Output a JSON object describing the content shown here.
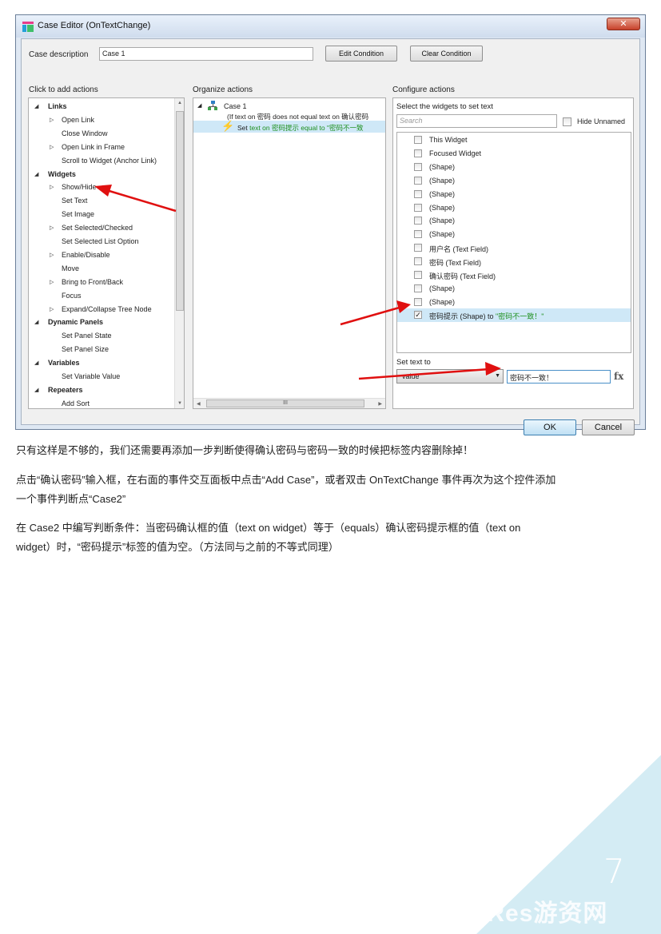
{
  "dialog": {
    "title": "Case Editor (OnTextChange)",
    "close_glyph": "✕",
    "case_description_label": "Case description",
    "case_description_value": "Case 1",
    "edit_condition_label": "Edit Condition",
    "clear_condition_label": "Clear Condition",
    "ok_label": "OK",
    "cancel_label": "Cancel"
  },
  "actions_panel": {
    "header": "Click to add actions",
    "rows": [
      {
        "label": "Links",
        "type": "category"
      },
      {
        "label": "Open Link",
        "type": "expandable"
      },
      {
        "label": "Close Window",
        "type": "item"
      },
      {
        "label": "Open Link in Frame",
        "type": "expandable"
      },
      {
        "label": "Scroll to Widget (Anchor Link)",
        "type": "item"
      },
      {
        "label": "Widgets",
        "type": "category"
      },
      {
        "label": "Show/Hide",
        "type": "expandable"
      },
      {
        "label": "Set Text",
        "type": "item"
      },
      {
        "label": "Set Image",
        "type": "item"
      },
      {
        "label": "Set Selected/Checked",
        "type": "expandable"
      },
      {
        "label": "Set Selected List Option",
        "type": "item"
      },
      {
        "label": "Enable/Disable",
        "type": "expandable"
      },
      {
        "label": "Move",
        "type": "item"
      },
      {
        "label": "Bring to Front/Back",
        "type": "expandable"
      },
      {
        "label": "Focus",
        "type": "item"
      },
      {
        "label": "Expand/Collapse Tree Node",
        "type": "expandable"
      },
      {
        "label": "Dynamic Panels",
        "type": "category"
      },
      {
        "label": "Set Panel State",
        "type": "item"
      },
      {
        "label": "Set Panel Size",
        "type": "item"
      },
      {
        "label": "Variables",
        "type": "category"
      },
      {
        "label": "Set Variable Value",
        "type": "item"
      },
      {
        "label": "Repeaters",
        "type": "category"
      },
      {
        "label": "Add Sort",
        "type": "item"
      }
    ]
  },
  "organize_panel": {
    "header": "Organize actions",
    "case_label": "Case 1",
    "condition_text": "(If text on 密码 does not equal text on 确认密码",
    "action_prefix": "Set ",
    "action_text": "text on 密码提示 equal to \"密码不一致",
    "scroll_thumb_glyph": "III"
  },
  "configure_panel": {
    "header": "Configure actions",
    "select_label": "Select the widgets to set text",
    "search_placeholder": "Search",
    "hide_unnamed_label": "Hide Unnamed",
    "widgets": [
      {
        "label": "This Widget",
        "checked": false
      },
      {
        "label": "Focused Widget",
        "checked": false
      },
      {
        "label": "(Shape)",
        "checked": false
      },
      {
        "label": "(Shape)",
        "checked": false
      },
      {
        "label": "(Shape)",
        "checked": false
      },
      {
        "label": "(Shape)",
        "checked": false
      },
      {
        "label": "(Shape)",
        "checked": false
      },
      {
        "label": "(Shape)",
        "checked": false
      },
      {
        "label": "用户名 (Text Field)",
        "checked": false
      },
      {
        "label": "密码 (Text Field)",
        "checked": false
      },
      {
        "label": "确认密码 (Text Field)",
        "checked": false
      },
      {
        "label": "(Shape)",
        "checked": false
      },
      {
        "label": "(Shape)",
        "checked": false
      }
    ],
    "selected_widget": {
      "label": "密码提示 (Shape) to ",
      "value": "\"密码不一致！\"",
      "checked": true
    },
    "set_text_to_label": "Set text to",
    "value_type": "value",
    "value_text": "密码不一致！",
    "fx_label": "fx"
  },
  "paragraphs": [
    "只有这样是不够的，我们还需要再添加一步判断使得确认密码与密码一致的时候把标签内容删除掉！",
    "点击“确认密码”输入框，在右面的事件交互面板中点击“Add Case”，或者双击 OnTextChange 事件再次为这个控件添加",
    "一个事件判断点“Case2”",
    "在 Case2 中编写判断条件：当密码确认框的值（text on widget）等于（equals）确认密码提示框的值（text on",
    "widget）时，“密码提示”标签的值为空。（方法同与之前的不等式同理）"
  ],
  "footer": {
    "page_number": "7",
    "watermark": "GameRes游资网"
  },
  "colors": {
    "arrow": "#e01010",
    "selected_row": "#cfe8f7",
    "corner": "#d4ecf4",
    "green_text": "#1d8f1d"
  }
}
